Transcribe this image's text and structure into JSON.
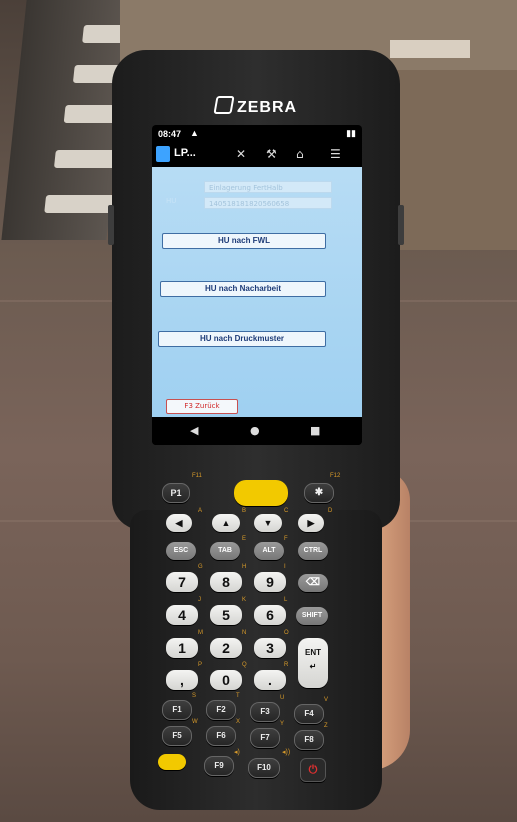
{
  "device": {
    "brand": "ZEBRA"
  },
  "status_bar": {
    "time": "08:47",
    "warning": "▲",
    "battery": "▮▮"
  },
  "toolbar": {
    "title": "LP...",
    "icons": [
      "close-icon",
      "wrench-icon",
      "home-icon",
      "menu-icon"
    ]
  },
  "form": {
    "label": "HU",
    "storage_value": "Einlagerung FertHalb",
    "hu_number_value": "140518181820560658"
  },
  "buttons": {
    "hu_fwl": "HU nach FWL",
    "hu_nacharbeit": "HU nach Nacharbeit",
    "hu_druckmuster": "HU nach Druckmuster",
    "back": "F3 Zurück"
  },
  "nav_bar": {
    "back": "◀",
    "home": "●",
    "recent": "■"
  },
  "keypad": {
    "p1": "P1",
    "star": "✱",
    "esc": "ESC",
    "tab": "TAB",
    "alt": "ALT",
    "ctrl": "CTRL",
    "shift": "SHIFT",
    "ent": "ENT",
    "f1": "F1",
    "f2": "F2",
    "f3": "F3",
    "f4": "F4",
    "f5": "F5",
    "f6": "F6",
    "f7": "F7",
    "f8": "F8",
    "f9": "F9",
    "f10": "F10",
    "digits": [
      "7",
      "8",
      "9",
      "4",
      "5",
      "6",
      "1",
      "2",
      "3",
      ",",
      "0",
      "."
    ],
    "alt_letters": [
      "F11",
      "F12",
      "A",
      "B",
      "C",
      "D",
      "E",
      "F",
      "G",
      "H",
      "I",
      "J",
      "K",
      "L",
      "M",
      "N",
      "O",
      "P",
      "Q",
      "R",
      "S",
      "T",
      "U",
      "V",
      "W",
      "X",
      "Y",
      "Z"
    ]
  },
  "colors": {
    "screen_bg": "#aed8f3",
    "button_text": "#1e3c78",
    "back_text": "#d02828",
    "scan_key": "#f2c900",
    "device_body": "#232323"
  }
}
